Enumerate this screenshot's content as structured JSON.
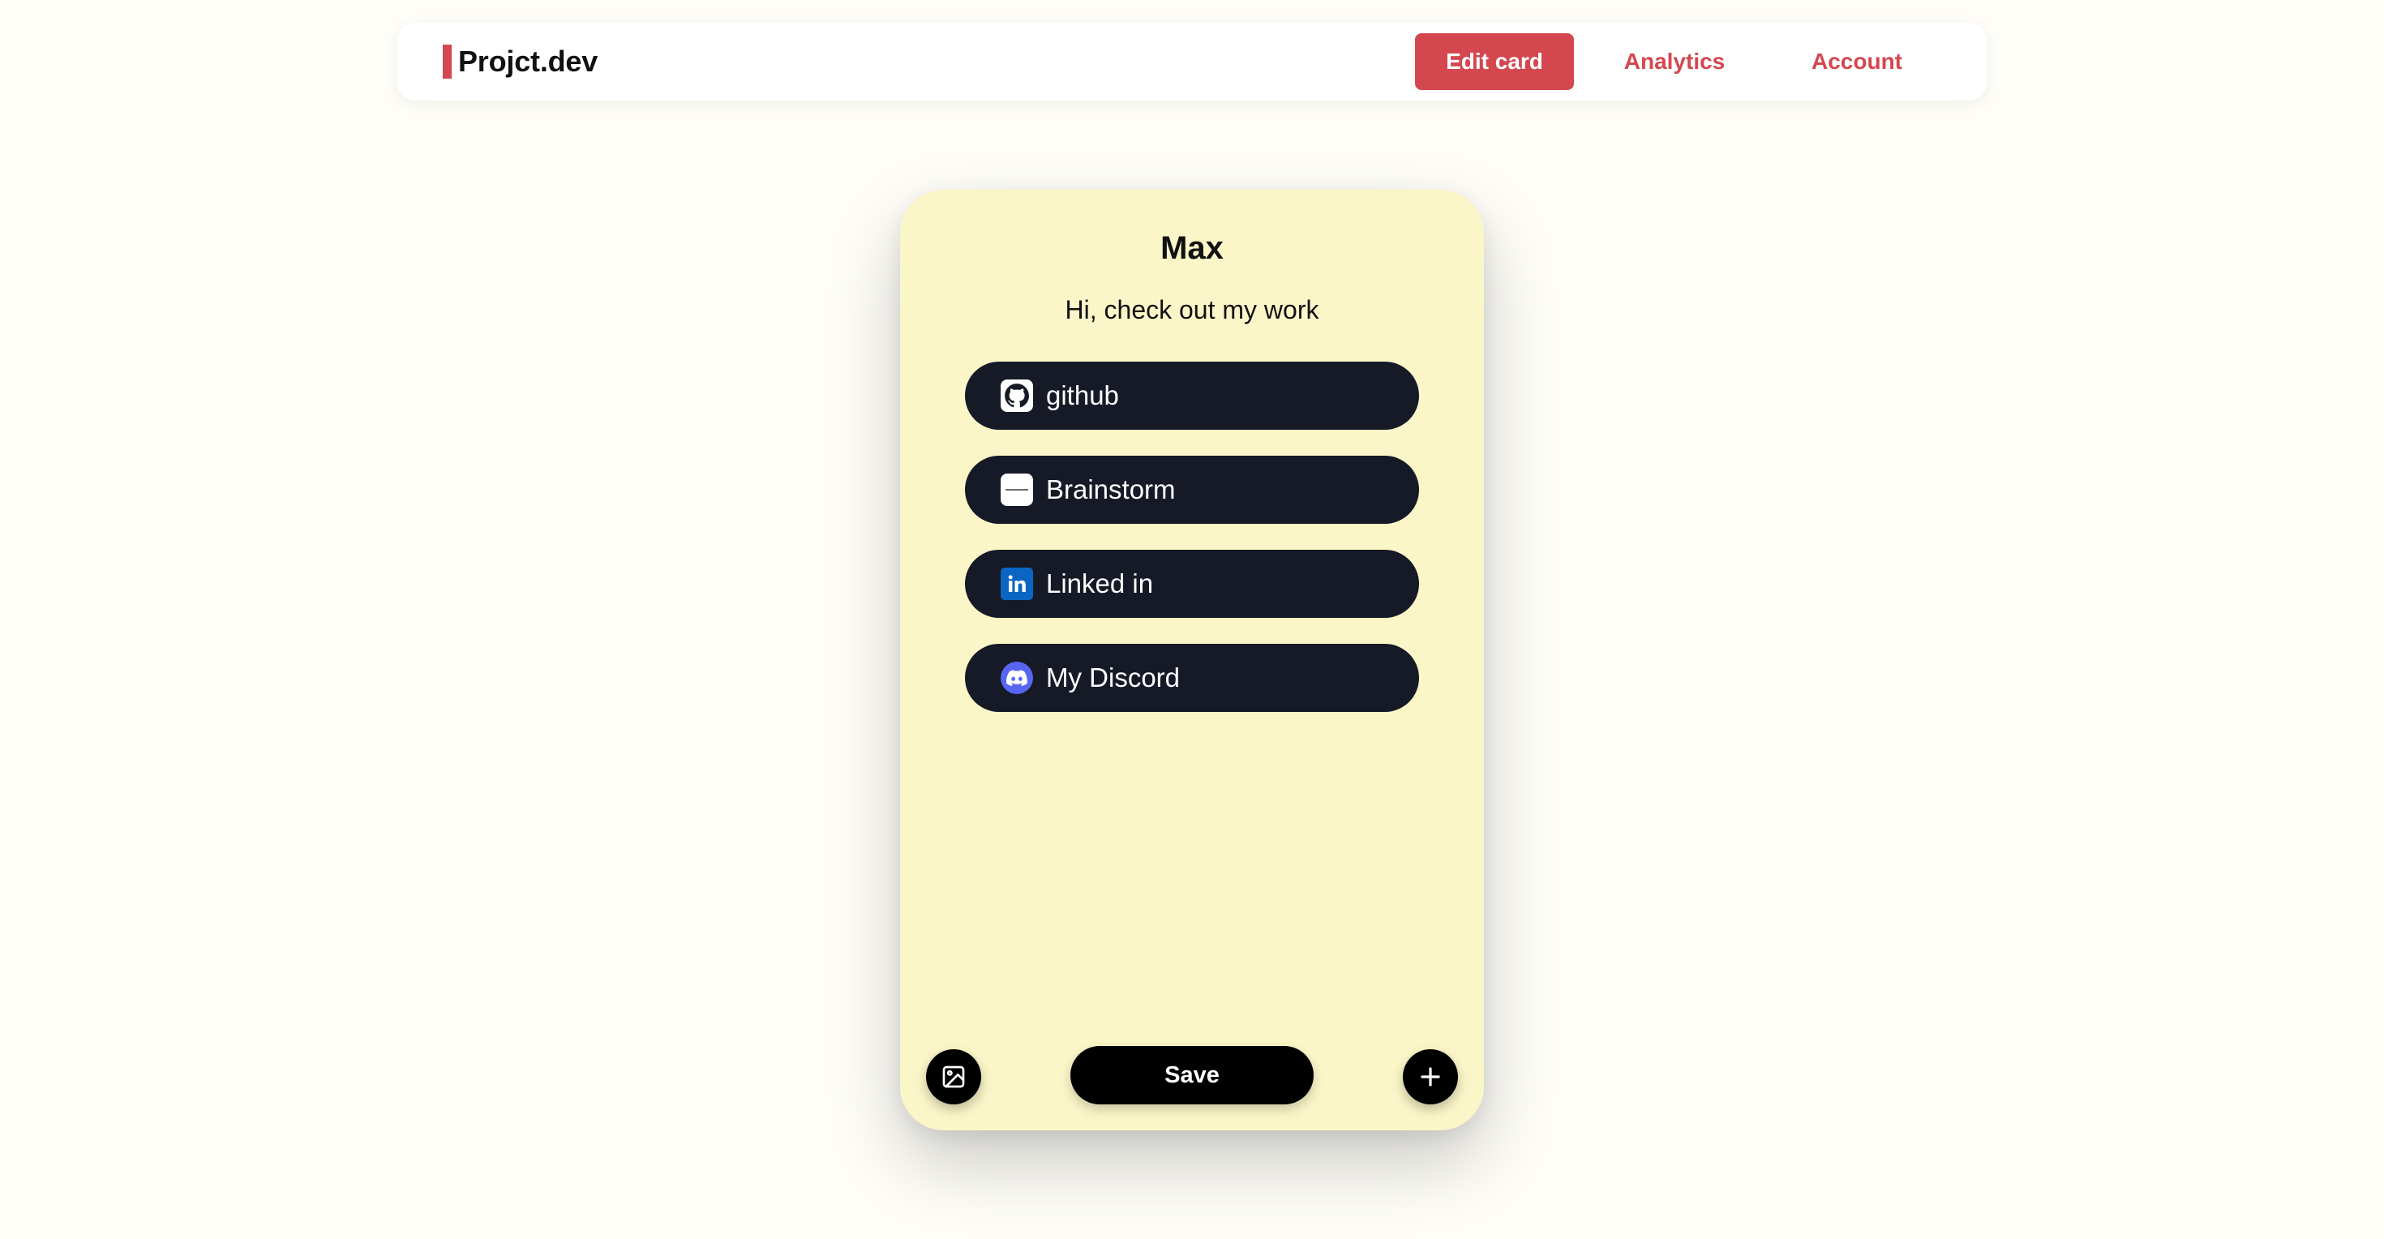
{
  "nav": {
    "brand": "Projct.dev",
    "items": [
      {
        "label": "Edit card"
      },
      {
        "label": "Analytics"
      },
      {
        "label": "Account"
      }
    ]
  },
  "card": {
    "name": "Max",
    "bio": "Hi, check out my work",
    "links": [
      {
        "label": "github",
        "icon": "github-icon"
      },
      {
        "label": "Brainstorm",
        "icon": "brainstorm-icon"
      },
      {
        "label": "Linked in",
        "icon": "linkedin-icon"
      },
      {
        "label": "My Discord",
        "icon": "discord-icon"
      }
    ],
    "save_label": "Save",
    "image_button_icon": "image-icon",
    "add_button_icon": "plus-icon"
  },
  "colors": {
    "accent": "#d4474f",
    "card_bg": "#fbf6c8",
    "link_bg": "#151a26",
    "page_bg": "#fefdf8",
    "discord": "#5865f2",
    "linkedin": "#0a66c2"
  }
}
